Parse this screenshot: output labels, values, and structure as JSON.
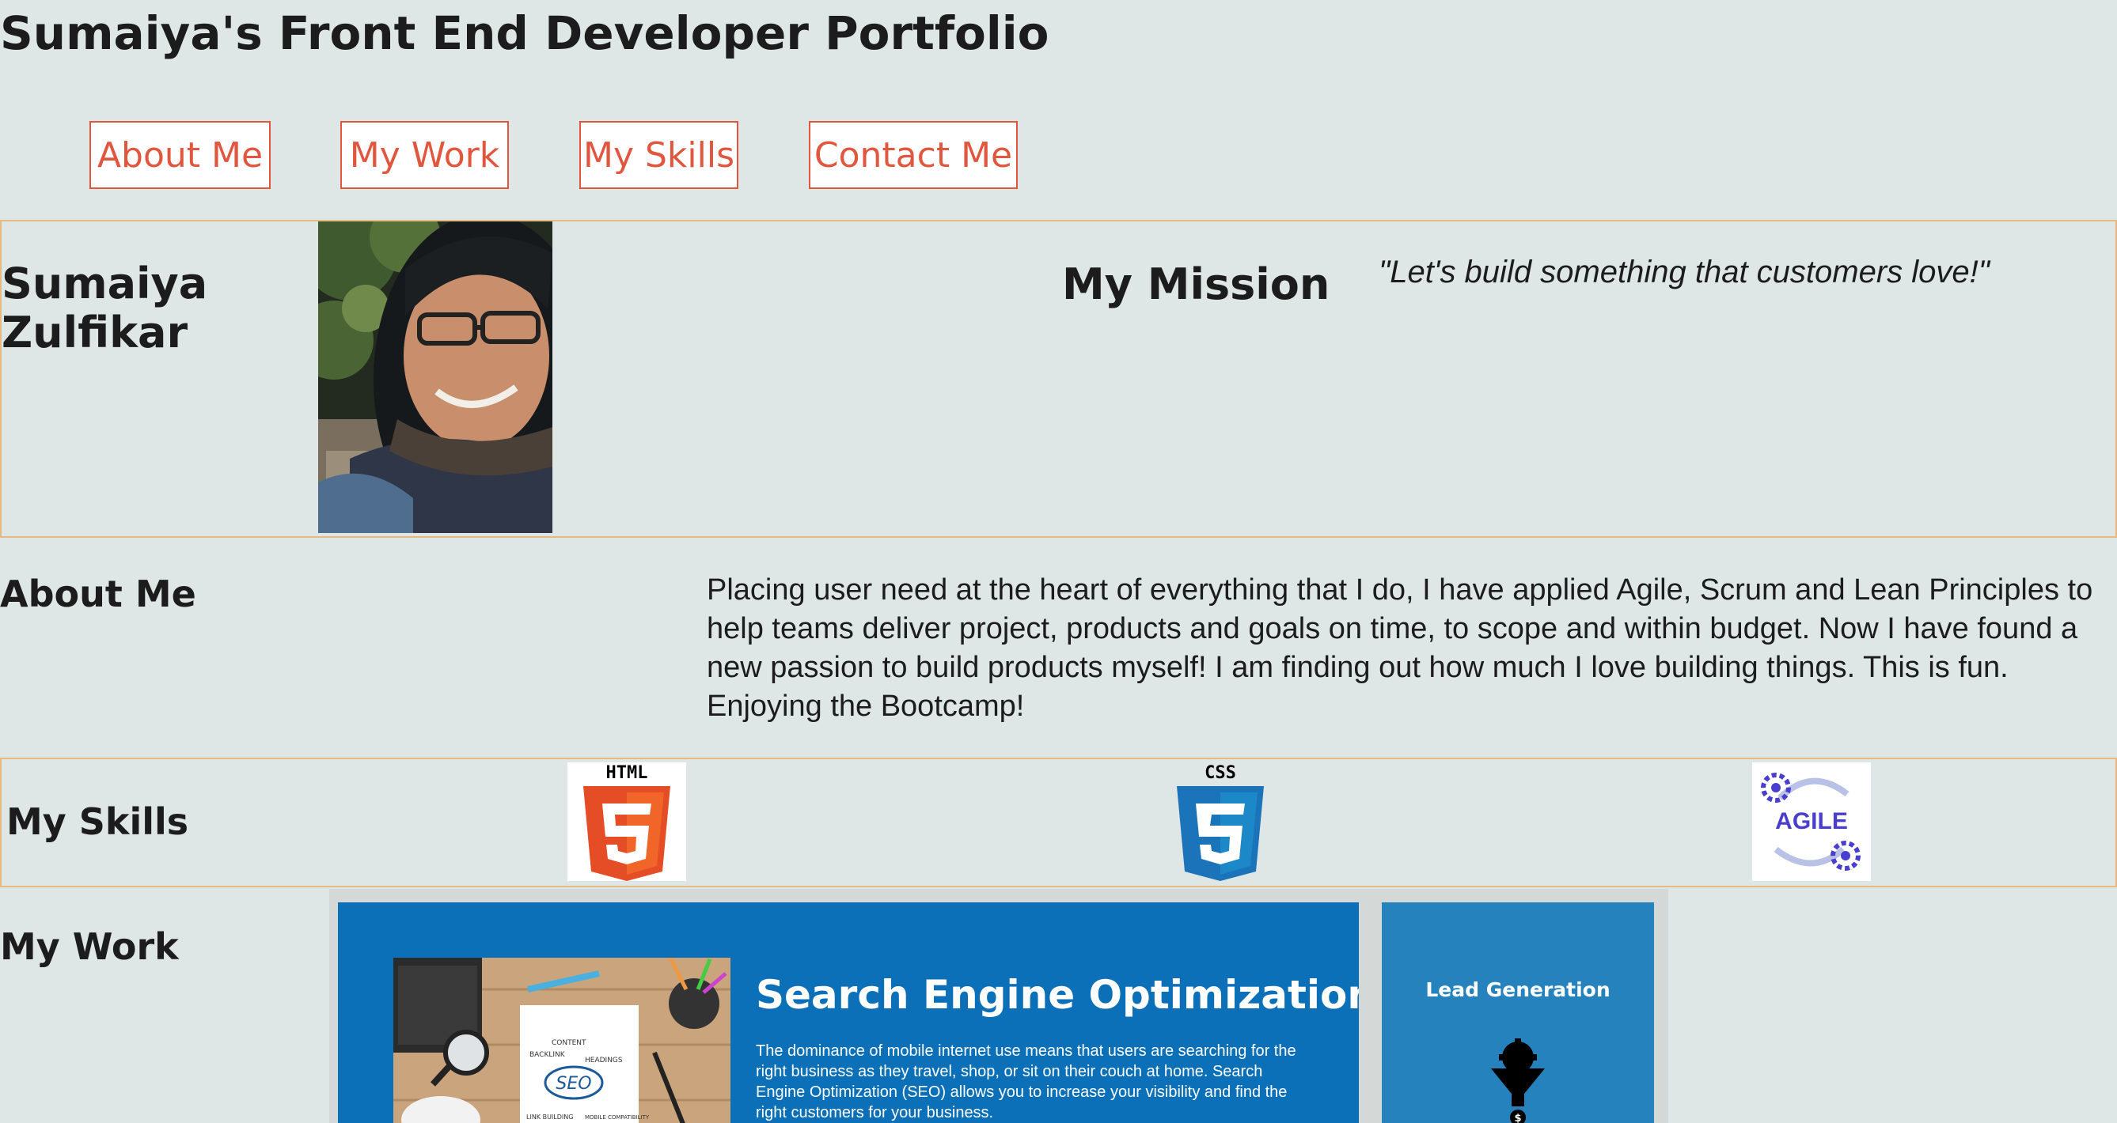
{
  "page_title": "Sumaiya's Front End Developer Portfolio",
  "nav": {
    "about": "About Me",
    "work": "My Work",
    "skills": "My Skills",
    "contact": "Contact Me"
  },
  "header": {
    "name_line1": "Sumaiya",
    "name_line2": "Zulfikar",
    "mission_heading": "My Mission",
    "mission_quote": "\"Let's build something that customers love!\""
  },
  "about": {
    "heading": "About Me",
    "text": "Placing user need at the heart of everything that I do, I have applied Agile, Scrum and Lean Principles to help teams deliver project, products and goals on time, to scope and within budget. Now I have found a new passion to build products myself! I am finding out how much I love building things. This is fun. Enjoying the Bootcamp!"
  },
  "skills": {
    "heading": "My Skills",
    "html_label": "HTML",
    "css_label": "CSS",
    "agile_label": "AGILE"
  },
  "work": {
    "heading": "My Work",
    "seo_title": "Search Engine Optimization",
    "seo_desc": "The dominance of mobile internet use means that users are searching for the right business as they travel, shop, or sit on their couch at home. Search Engine Optimization (SEO) allows you to increase your visibility and find the right customers for your business.",
    "seo_notebook_word": "SEO",
    "seo_note_content": "CONTENT",
    "seo_note_backlink": "BACKLINK",
    "seo_note_headings": "HEADINGS",
    "seo_note_linkbuilding": "LINK BUILDING",
    "seo_note_mobile": "MOBILE COMPATIBILITY",
    "lead_title": "Lead Generation",
    "lead_icon_symbol": "$"
  },
  "colors": {
    "accent": "#e0563e",
    "border": "#e6b983",
    "background": "#dfe6e6",
    "html_orange": "#e44d26",
    "css_blue": "#1b73ba",
    "seo_blue": "#0b70b8",
    "lead_blue": "#2682bc"
  }
}
